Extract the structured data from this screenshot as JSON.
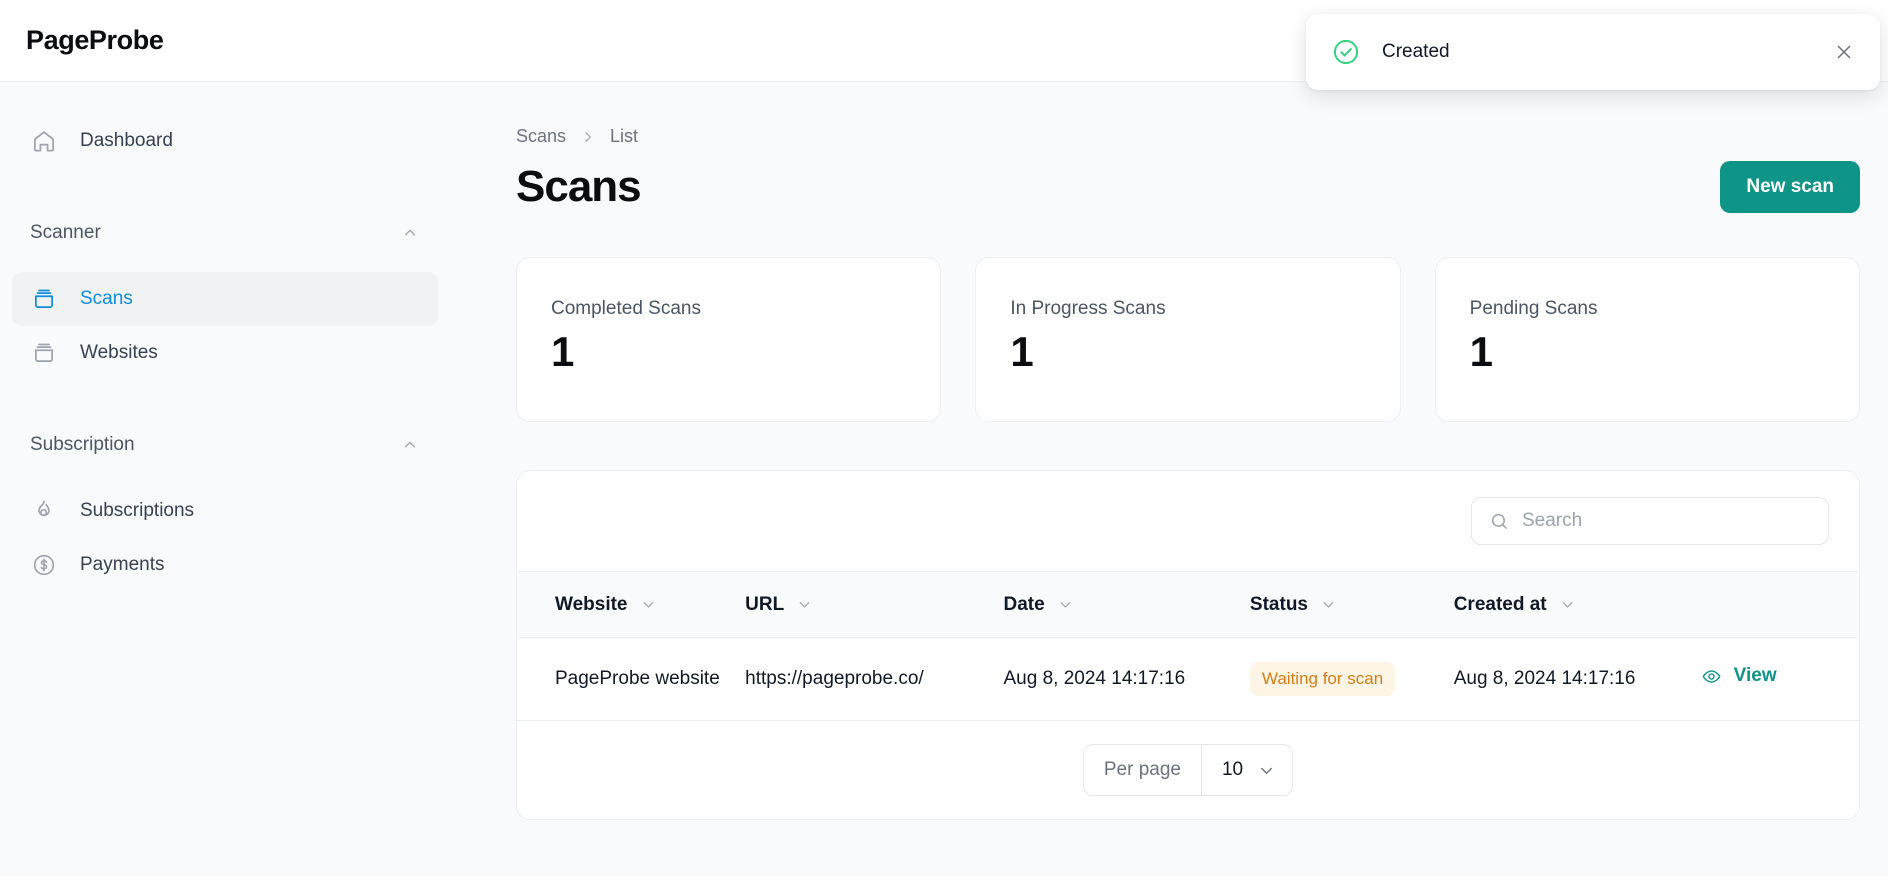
{
  "app": {
    "brand": "PageProbe"
  },
  "toast": {
    "message": "Created",
    "icon": "check-circle-icon",
    "close_icon": "close-icon",
    "accent": "#22c55e"
  },
  "sidebar": {
    "dashboard": {
      "label": "Dashboard",
      "icon": "home-icon"
    },
    "groups": [
      {
        "label": "Scanner",
        "chevron": "chevron-up-icon",
        "items": [
          {
            "label": "Scans",
            "icon": "scans-icon",
            "active": true
          },
          {
            "label": "Websites",
            "icon": "websites-icon",
            "active": false
          }
        ]
      },
      {
        "label": "Subscription",
        "chevron": "chevron-up-icon",
        "items": [
          {
            "label": "Subscriptions",
            "icon": "flame-icon",
            "active": false
          },
          {
            "label": "Payments",
            "icon": "dollar-circle-icon",
            "active": false
          }
        ]
      }
    ],
    "active_color": "#0d8ddb"
  },
  "main": {
    "breadcrumb": {
      "parent": "Scans",
      "separator": "chevron-right-icon",
      "current": "List"
    },
    "title": "Scans",
    "new_scan_button": "New scan",
    "primary_color": "#0f9488"
  },
  "stats": [
    {
      "label": "Completed Scans",
      "value": "1"
    },
    {
      "label": "In Progress Scans",
      "value": "1"
    },
    {
      "label": "Pending Scans",
      "value": "1"
    }
  ],
  "table": {
    "search": {
      "placeholder": "Search",
      "value": "",
      "icon": "search-icon"
    },
    "columns": [
      {
        "label": "Website",
        "sort_icon": "chevron-down-icon"
      },
      {
        "label": "URL",
        "sort_icon": "chevron-down-icon"
      },
      {
        "label": "Date",
        "sort_icon": "chevron-down-icon"
      },
      {
        "label": "Status",
        "sort_icon": "chevron-down-icon"
      },
      {
        "label": "Created at",
        "sort_icon": "chevron-down-icon"
      }
    ],
    "rows": [
      {
        "website": "PageProbe website",
        "url": "https://pageprobe.co/",
        "date": "Aug 8, 2024 14:17:16",
        "status": "Waiting for scan",
        "status_color": "#d97b15",
        "status_bg": "#fdf6e7",
        "created_at": "Aug 8, 2024 14:17:16",
        "action_label": "View",
        "action_icon": "eye-icon"
      }
    ],
    "footer": {
      "per_page_label": "Per page",
      "per_page_value": "10",
      "per_page_chevron": "chevron-down-icon"
    }
  }
}
